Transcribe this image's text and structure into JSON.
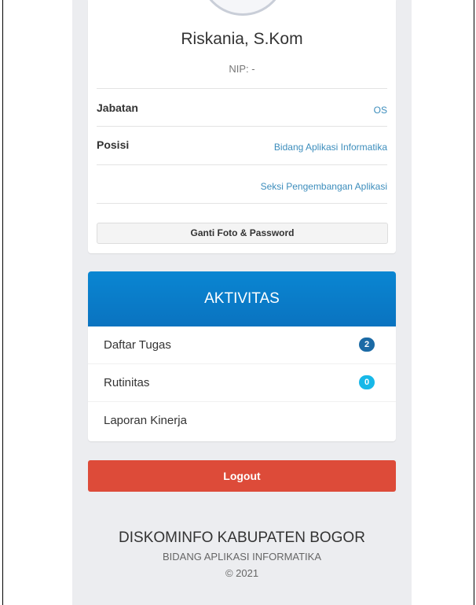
{
  "profile": {
    "name": "Riskania, S.Kom",
    "nip": "NIP: -",
    "rows": [
      {
        "label": "Jabatan",
        "value": "OS"
      },
      {
        "label": "Posisi",
        "value": "Bidang Aplikasi Informatika"
      },
      {
        "label": "",
        "value": "Seksi Pengembangan Aplikasi"
      }
    ],
    "change_button": "Ganti Foto & Password"
  },
  "activity": {
    "title": "AKTIVITAS",
    "items": [
      {
        "label": "Daftar Tugas",
        "badge": "2",
        "badge_color": "#1b6aa5"
      },
      {
        "label": "Rutinitas",
        "badge": "0",
        "badge_color": "#17b8e8"
      },
      {
        "label": "Laporan Kinerja",
        "badge": ""
      }
    ]
  },
  "logout": {
    "label": "Logout",
    "color": "#dd4b39"
  },
  "footer": {
    "org": "DISKOMINFO KABUPATEN BOGOR",
    "dept": "BIDANG APLIKASI INFORMATIKA",
    "copyright": "© 2021"
  },
  "colors": {
    "accent": "#0a80cc",
    "link": "#3c8dbc",
    "background": "#ecedf0"
  }
}
